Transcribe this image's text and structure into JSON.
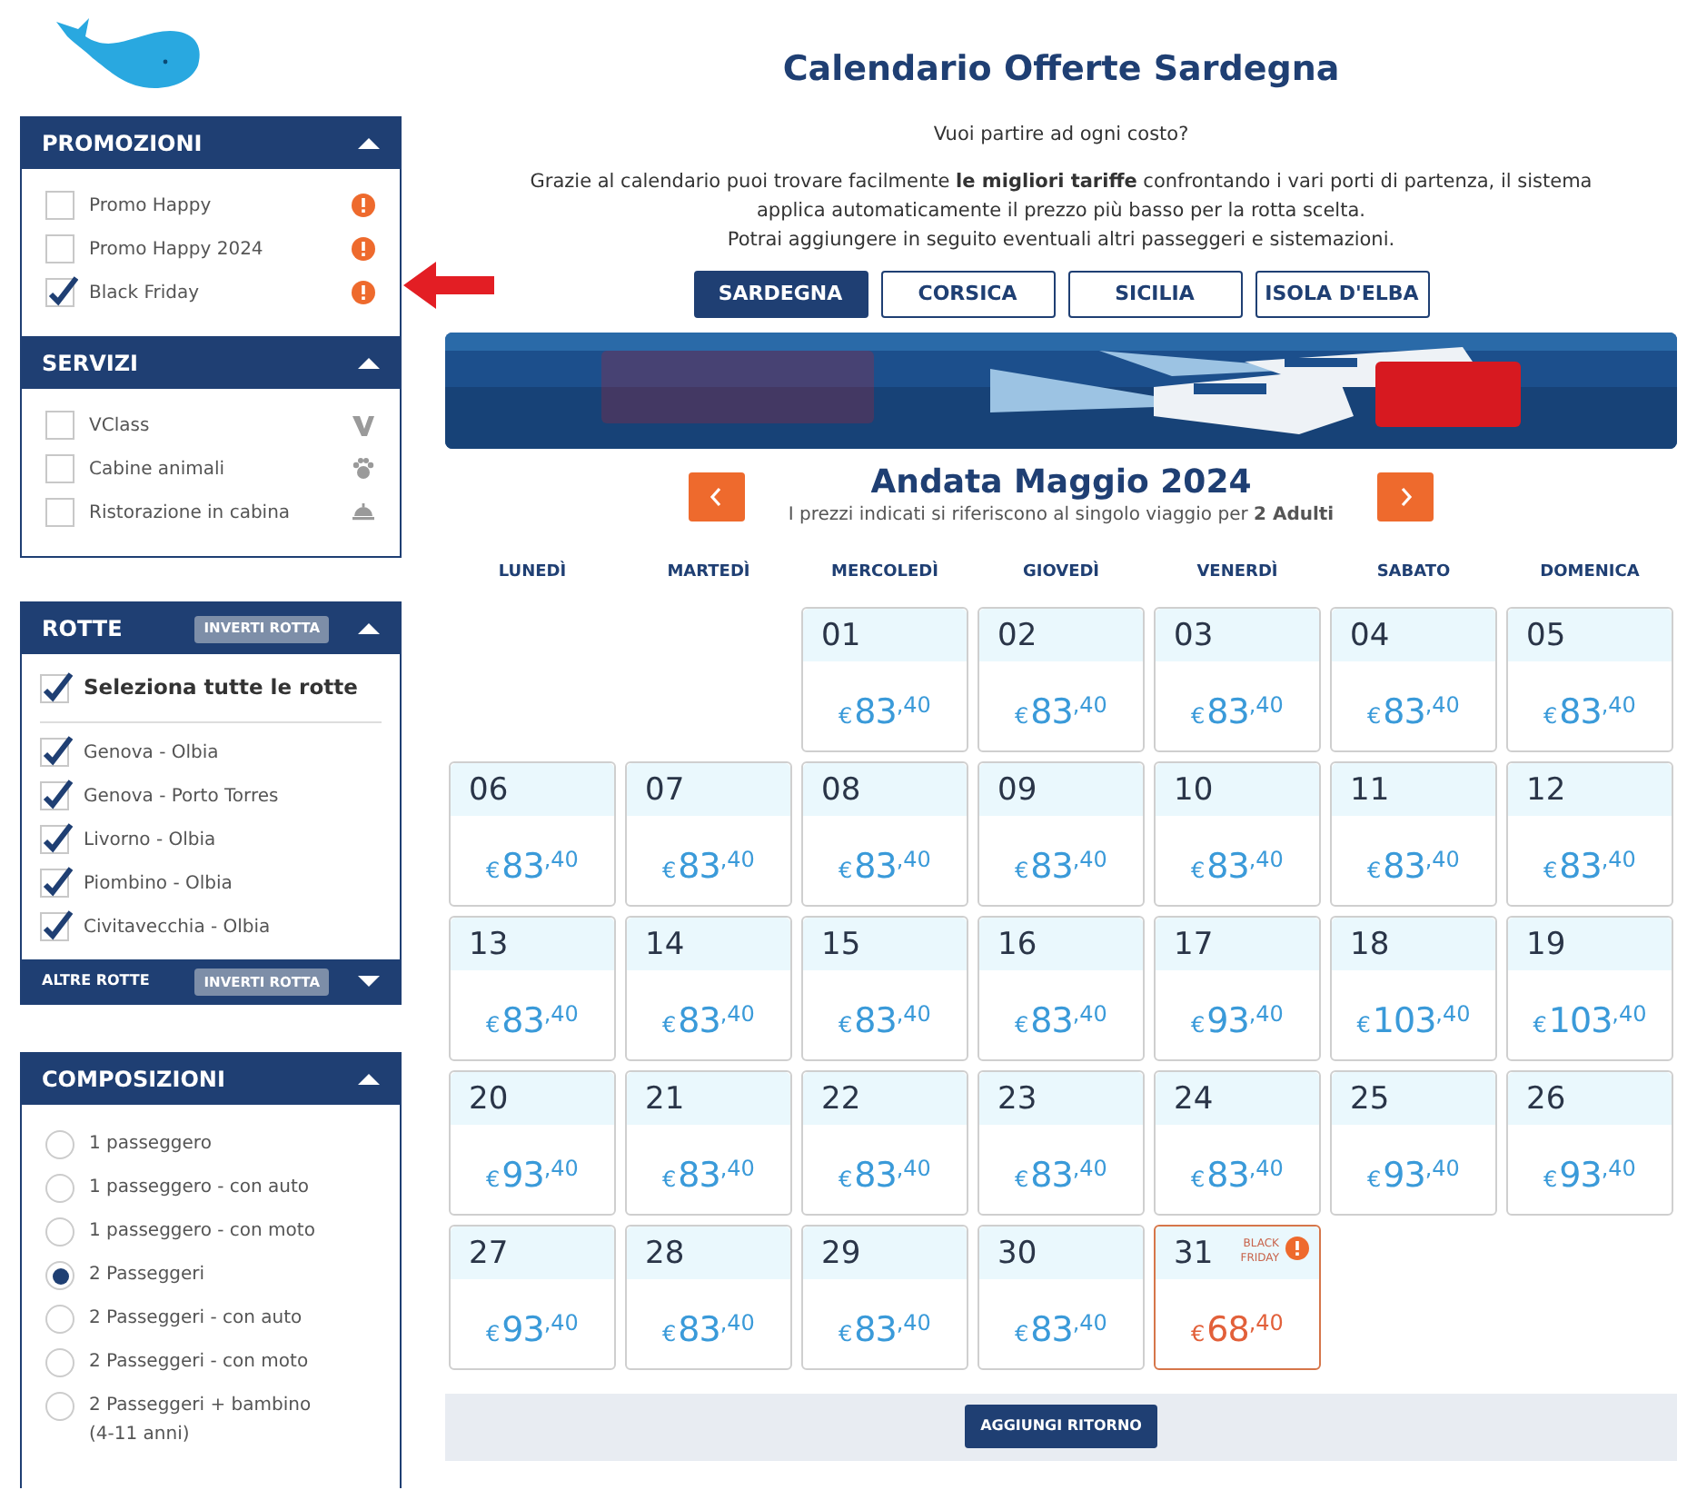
{
  "sidebar": {
    "panels": [
      {
        "kind": "promo",
        "title": "PROMOZIONI",
        "expanded": true,
        "items": [
          {
            "label": "Promo Happy",
            "checked": false
          },
          {
            "label": "Promo Happy 2024",
            "checked": false
          },
          {
            "label": "Black Friday",
            "checked": true
          }
        ]
      },
      {
        "kind": "service",
        "title": "SERVIZI",
        "expanded": true,
        "items": [
          {
            "label": "VClass",
            "checked": false
          },
          {
            "label": "Cabine animali",
            "checked": false
          },
          {
            "label": "Ristorazione in cabina",
            "checked": false
          }
        ]
      },
      {
        "kind": "routes",
        "title": "ROTTE",
        "button": "INVERTI ROTTA",
        "expanded": true,
        "select_all": {
          "label": "Seleziona tutte le rotte",
          "checked": true
        },
        "items": [
          {
            "label": "Genova - Olbia",
            "checked": true
          },
          {
            "label": "Genova - Porto Torres",
            "checked": true
          },
          {
            "label": "Livorno - Olbia",
            "checked": true
          },
          {
            "label": "Piombino - Olbia",
            "checked": true
          },
          {
            "label": "Civitavecchia - Olbia",
            "checked": true
          }
        ],
        "footer": {
          "label": "ALTRE ROTTE",
          "button": "INVERTI ROTTA",
          "expanded": false
        }
      },
      {
        "kind": "radios",
        "title": "COMPOSIZIONI",
        "expanded": true,
        "items": [
          {
            "label": "1 passeggero",
            "selected": false
          },
          {
            "label": "1 passeggero - con auto",
            "selected": false
          },
          {
            "label": "1 passeggero - con moto",
            "selected": false
          },
          {
            "label": "2 Passeggeri",
            "selected": true
          },
          {
            "label": "2 Passeggeri - con auto",
            "selected": false
          },
          {
            "label": "2 Passeggeri - con moto",
            "selected": false
          },
          {
            "label": "2 Passeggeri + bambino (4-11 anni)",
            "selected": false
          }
        ]
      }
    ]
  },
  "main": {
    "title": "Calendario Offerte Sardegna",
    "subtitle": "Vuoi partire ad ogni costo?",
    "intro": "Grazie al calendario puoi trovare facilmente **le migliori tariffe** confrontando i vari porti di partenza, il sistema applica automaticamente il prezzo più basso per la rotta scelta.",
    "note": "Potrai aggiungere in seguito eventuali altri passeggeri e sistemazioni.",
    "tabs": [
      {
        "label": "SARDEGNA",
        "selected": true
      },
      {
        "label": "CORSICA",
        "selected": false
      },
      {
        "label": "SICILIA",
        "selected": false
      },
      {
        "label": "ISOLA D'ELBA",
        "selected": false
      }
    ],
    "month": {
      "title": "Andata Maggio 2024",
      "caption": "I prezzi indicati si riferiscono al singolo viaggio per **2 Adulti**"
    },
    "weekdays": [
      "LUNEDÌ",
      "MARTEDÌ",
      "MERCOLEDÌ",
      "GIOVEDÌ",
      "VENERDÌ",
      "SABATO",
      "DOMENICA"
    ],
    "weeks": [
      [
        {
          "kind": "blank"
        },
        {
          "kind": "blank"
        },
        {
          "day": "01",
          "currency": "€",
          "amount": "83",
          "cents": ",40",
          "kind": "normal"
        },
        {
          "day": "02",
          "currency": "€",
          "amount": "83",
          "cents": ",40",
          "kind": "normal"
        },
        {
          "day": "03",
          "currency": "€",
          "amount": "83",
          "cents": ",40",
          "kind": "normal"
        },
        {
          "day": "04",
          "currency": "€",
          "amount": "83",
          "cents": ",40",
          "kind": "normal"
        },
        {
          "day": "05",
          "currency": "€",
          "amount": "83",
          "cents": ",40",
          "kind": "normal"
        }
      ],
      [
        {
          "day": "06",
          "currency": "€",
          "amount": "83",
          "cents": ",40",
          "kind": "normal"
        },
        {
          "day": "07",
          "currency": "€",
          "amount": "83",
          "cents": ",40",
          "kind": "normal"
        },
        {
          "day": "08",
          "currency": "€",
          "amount": "83",
          "cents": ",40",
          "kind": "normal"
        },
        {
          "day": "09",
          "currency": "€",
          "amount": "83",
          "cents": ",40",
          "kind": "normal"
        },
        {
          "day": "10",
          "currency": "€",
          "amount": "83",
          "cents": ",40",
          "kind": "normal"
        },
        {
          "day": "11",
          "currency": "€",
          "amount": "83",
          "cents": ",40",
          "kind": "normal"
        },
        {
          "day": "12",
          "currency": "€",
          "amount": "83",
          "cents": ",40",
          "kind": "normal"
        }
      ],
      [
        {
          "day": "13",
          "currency": "€",
          "amount": "83",
          "cents": ",40",
          "kind": "normal"
        },
        {
          "day": "14",
          "currency": "€",
          "amount": "83",
          "cents": ",40",
          "kind": "normal"
        },
        {
          "day": "15",
          "currency": "€",
          "amount": "83",
          "cents": ",40",
          "kind": "normal"
        },
        {
          "day": "16",
          "currency": "€",
          "amount": "83",
          "cents": ",40",
          "kind": "normal"
        },
        {
          "day": "17",
          "currency": "€",
          "amount": "93",
          "cents": ",40",
          "kind": "normal"
        },
        {
          "day": "18",
          "currency": "€",
          "amount": "103",
          "cents": ",40",
          "kind": "normal"
        },
        {
          "day": "19",
          "currency": "€",
          "amount": "103",
          "cents": ",40",
          "kind": "normal"
        }
      ],
      [
        {
          "day": "20",
          "currency": "€",
          "amount": "93",
          "cents": ",40",
          "kind": "normal"
        },
        {
          "day": "21",
          "currency": "€",
          "amount": "83",
          "cents": ",40",
          "kind": "normal"
        },
        {
          "day": "22",
          "currency": "€",
          "amount": "83",
          "cents": ",40",
          "kind": "normal"
        },
        {
          "day": "23",
          "currency": "€",
          "amount": "83",
          "cents": ",40",
          "kind": "normal"
        },
        {
          "day": "24",
          "currency": "€",
          "amount": "83",
          "cents": ",40",
          "kind": "normal"
        },
        {
          "day": "25",
          "currency": "€",
          "amount": "93",
          "cents": ",40",
          "kind": "normal"
        },
        {
          "day": "26",
          "currency": "€",
          "amount": "93",
          "cents": ",40",
          "kind": "normal"
        }
      ],
      [
        {
          "day": "27",
          "currency": "€",
          "amount": "93",
          "cents": ",40",
          "kind": "normal"
        },
        {
          "day": "28",
          "currency": "€",
          "amount": "83",
          "cents": ",40",
          "kind": "normal"
        },
        {
          "day": "29",
          "currency": "€",
          "amount": "83",
          "cents": ",40",
          "kind": "normal"
        },
        {
          "day": "30",
          "currency": "€",
          "amount": "83",
          "cents": ",40",
          "kind": "normal"
        },
        {
          "day": "31",
          "currency": "€",
          "amount": "68",
          "cents": ",40",
          "kind": "promo",
          "promo_label": "BLACK FRIDAY"
        }
      ]
    ],
    "return_button": "AGGIUNGI RITORNO"
  }
}
